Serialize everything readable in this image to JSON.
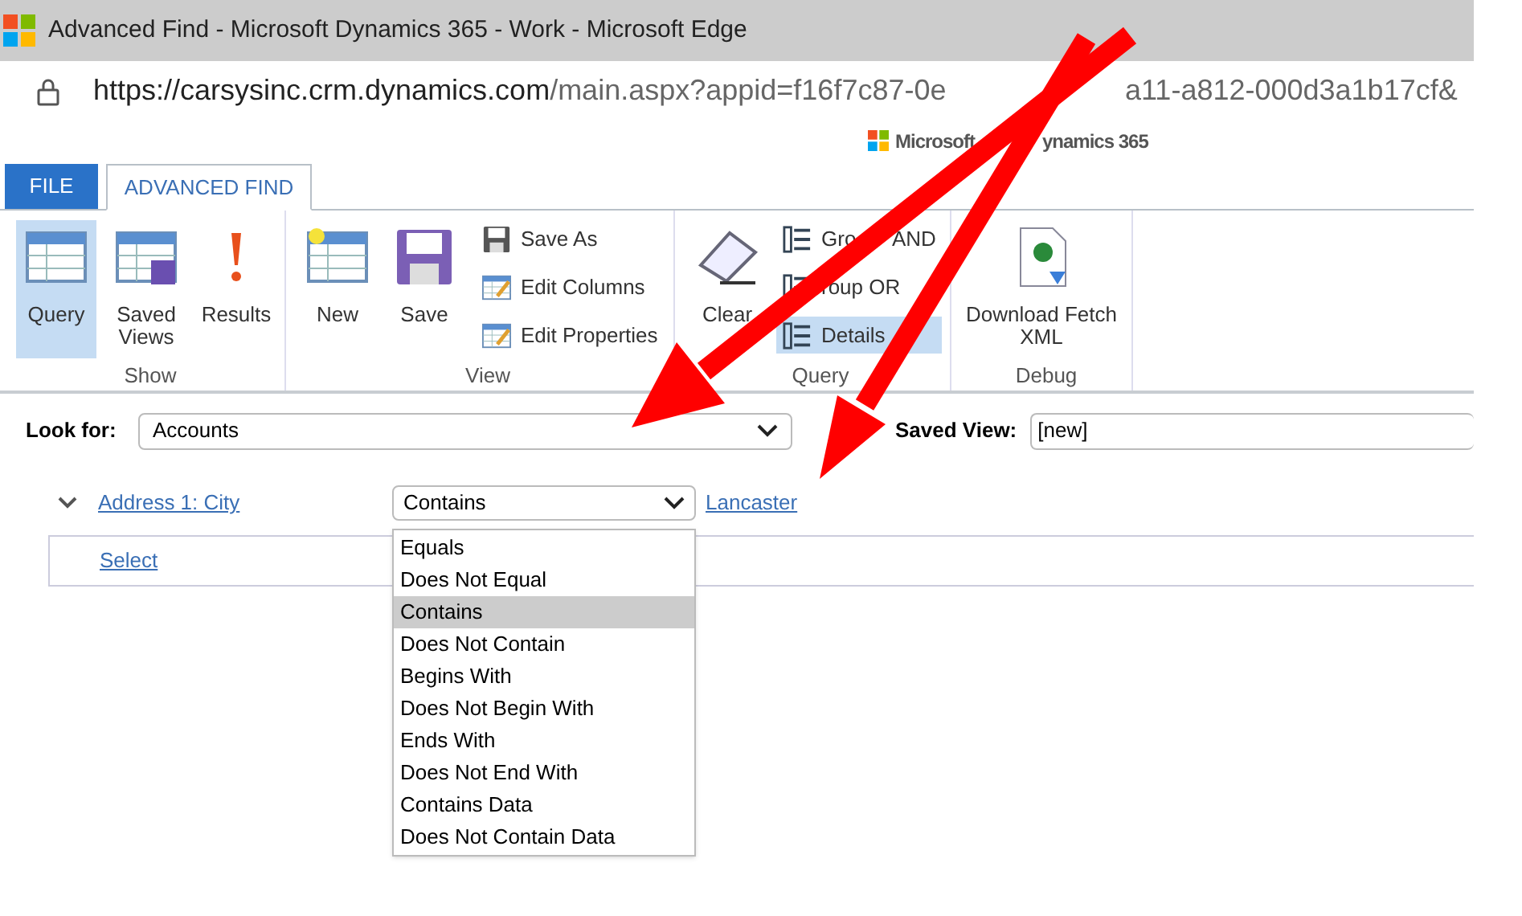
{
  "window": {
    "title": "Advanced Find - Microsoft Dynamics 365 - Work - Microsoft Edge"
  },
  "address_bar": {
    "host": "https://carsysinc.crm.dynamics.com",
    "path_visible": "/main.aspx?appid=f16f7c87-0e",
    "path_after_arrow": "a11-a812-000d3a1b17cf&"
  },
  "brand": {
    "left": "Microsoft",
    "right": "ynamics 365"
  },
  "tabs": [
    {
      "label": "FILE",
      "kind": "file",
      "selected": false
    },
    {
      "label": "ADVANCED FIND",
      "kind": "tab",
      "selected": true
    }
  ],
  "ribbon_groups": [
    {
      "label": "Show",
      "items": [
        {
          "label": "Query",
          "kind": "large",
          "selected": true
        },
        {
          "label": "Saved Views",
          "kind": "large",
          "selected": false
        },
        {
          "label": "Results",
          "kind": "large",
          "selected": false
        }
      ]
    },
    {
      "label": "View",
      "items": [
        {
          "label": "New",
          "kind": "large",
          "selected": false
        },
        {
          "label": "Save",
          "kind": "large",
          "selected": false
        },
        {
          "label": "Save As",
          "kind": "small",
          "selected": false
        },
        {
          "label": "Edit Columns",
          "kind": "small",
          "selected": false
        },
        {
          "label": "Edit Properties",
          "kind": "small",
          "selected": false
        }
      ]
    },
    {
      "label": "Query",
      "items": [
        {
          "label": "Clear",
          "kind": "large",
          "selected": false
        },
        {
          "label": "Gro",
          "label_after_arrow": "AND",
          "kind": "small",
          "selected": false
        },
        {
          "label": "roup OR",
          "kind": "small",
          "selected": false
        },
        {
          "label": "Details",
          "kind": "small",
          "selected": true
        }
      ]
    },
    {
      "label": "Debug",
      "items": [
        {
          "label": "Download Fetch XML",
          "kind": "large",
          "selected": false
        }
      ]
    }
  ],
  "look_for": {
    "label": "Look for:",
    "value": "Accounts"
  },
  "saved_view": {
    "label": "Saved View:",
    "value": "[new]"
  },
  "conditions": [
    {
      "field": "Address 1: City",
      "operator": "Contains",
      "value": "Lancaster",
      "expanded": true
    }
  ],
  "select_link": "Select",
  "operator_menu": [
    {
      "label": "Equals",
      "selected": false
    },
    {
      "label": "Does Not Equal",
      "selected": false
    },
    {
      "label": "Contains",
      "selected": true
    },
    {
      "label": "Does Not Contain",
      "selected": false
    },
    {
      "label": "Begins With",
      "selected": false
    },
    {
      "label": "Does Not Begin With",
      "selected": false
    },
    {
      "label": "Ends With",
      "selected": false
    },
    {
      "label": "Does Not End With",
      "selected": false
    },
    {
      "label": "Contains Data",
      "selected": false
    },
    {
      "label": "Does Not Contain Data",
      "selected": false
    }
  ]
}
